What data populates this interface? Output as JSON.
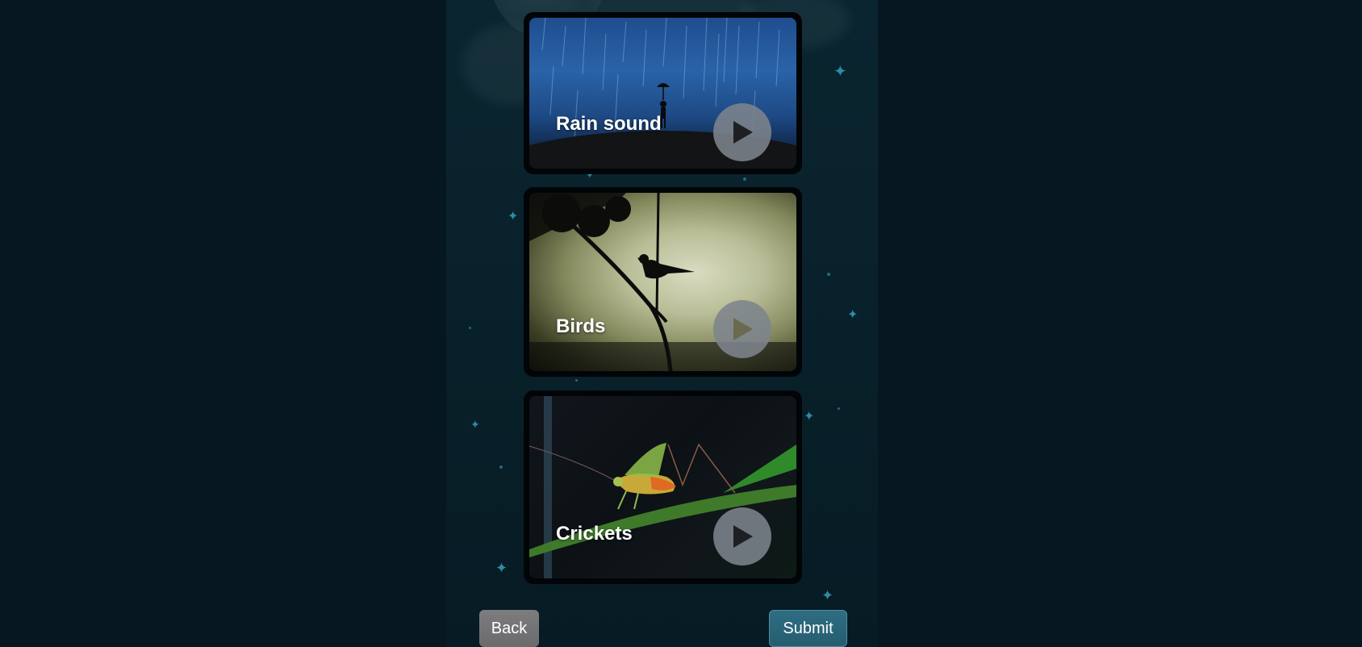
{
  "cards": [
    {
      "title": "Rain sound",
      "icon": "play-icon"
    },
    {
      "title": "Birds",
      "icon": "play-icon"
    },
    {
      "title": "Crickets",
      "icon": "play-icon"
    }
  ],
  "buttons": {
    "back_label": "Back",
    "submit_label": "Submit"
  },
  "colors": {
    "page_background": "#061720",
    "panel_background": "#0b2530",
    "submit_button": "#2f6d82",
    "back_button": "#7d7d7f",
    "play_button": "#7d848c"
  }
}
